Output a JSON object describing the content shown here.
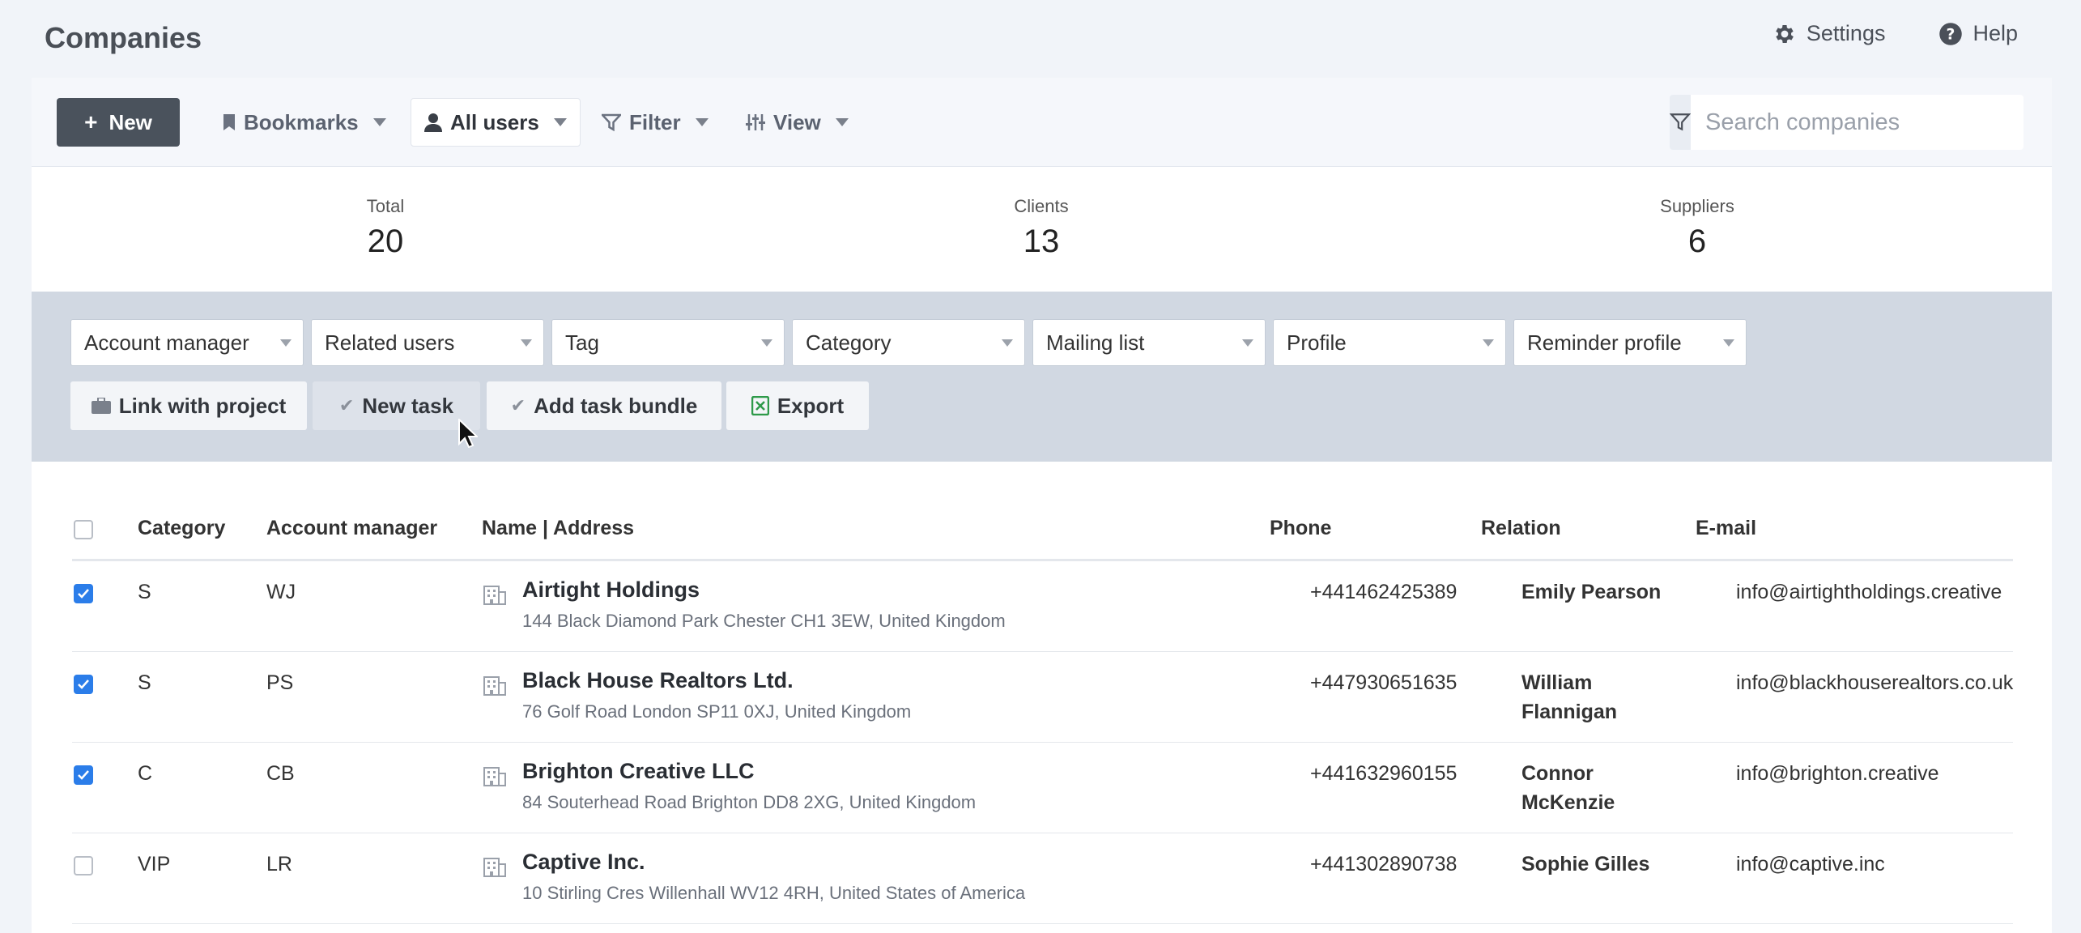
{
  "header": {
    "title": "Companies",
    "settings_label": "Settings",
    "help_label": "Help"
  },
  "toolbar": {
    "new_label": "New",
    "bookmarks_label": "Bookmarks",
    "users_label": "All users",
    "filter_label": "Filter",
    "view_label": "View",
    "search_placeholder": "Search companies"
  },
  "stats": [
    {
      "label": "Total",
      "value": "20"
    },
    {
      "label": "Clients",
      "value": "13"
    },
    {
      "label": "Suppliers",
      "value": "6"
    }
  ],
  "filters": [
    "Account manager",
    "Related users",
    "Tag",
    "Category",
    "Mailing list",
    "Profile",
    "Reminder profile"
  ],
  "actions": {
    "link_project": "Link with project",
    "new_task": "New task",
    "add_task_bundle": "Add task bundle",
    "export": "Export"
  },
  "table": {
    "columns": [
      "Category",
      "Account manager",
      "Name | Address",
      "Phone",
      "Relation",
      "E-mail"
    ],
    "rows": [
      {
        "checked": true,
        "category": "S",
        "manager": "WJ",
        "name": "Airtight Holdings",
        "address": "144 Black Diamond Park Chester CH1 3EW, United Kingdom",
        "phone": "+441462425389",
        "relation": "Emily Pearson",
        "email": "info@airtightholdings.creative"
      },
      {
        "checked": true,
        "category": "S",
        "manager": "PS",
        "name": "Black House Realtors Ltd.",
        "address": "76 Golf Road London SP11 0XJ, United Kingdom",
        "phone": "+447930651635",
        "relation": "William Flannigan",
        "email": "info@blackhouserealtors.co.uk"
      },
      {
        "checked": true,
        "category": "C",
        "manager": "CB",
        "name": "Brighton Creative LLC",
        "address": "84 Souterhead Road Brighton DD8 2XG, United Kingdom",
        "phone": "+441632960155",
        "relation": "Connor McKenzie",
        "email": "info@brighton.creative"
      },
      {
        "checked": false,
        "category": "VIP",
        "manager": "LR",
        "name": "Captive Inc.",
        "address": "10 Stirling Cres Willenhall WV12 4RH, United States of America",
        "phone": "+441302890738",
        "relation": "Sophie Gilles",
        "email": "info@captive.inc"
      }
    ]
  },
  "colors": {
    "accent": "#2b7de9",
    "new_button": "#4a525c",
    "filter_panel": "#d1d8e2",
    "export_icon": "#2e9a4a"
  }
}
